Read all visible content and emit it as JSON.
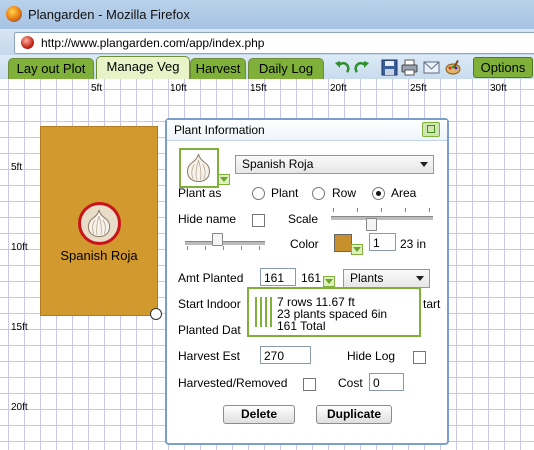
{
  "window": {
    "title": "Plangarden - Mozilla Firefox"
  },
  "browser": {
    "url": "http://www.plangarden.com/app/index.php"
  },
  "tabs": [
    {
      "label": "Lay out Plot",
      "active": false
    },
    {
      "label": "Manage Veg",
      "active": true
    },
    {
      "label": "Harvest",
      "active": false
    },
    {
      "label": "Daily Log",
      "active": false
    }
  ],
  "toolbar": {
    "icons": [
      "undo-icon",
      "redo-icon",
      "save-icon",
      "print-icon",
      "email-icon",
      "paint-icon"
    ],
    "options_label": "Options"
  },
  "ruler": {
    "top": [
      "5ft",
      "10ft",
      "15ft",
      "20ft",
      "25ft",
      "30ft"
    ],
    "left": [
      "5ft",
      "10ft",
      "15ft",
      "20ft"
    ]
  },
  "bed": {
    "label": "Spanish Roja",
    "icon": "garlic-icon",
    "color": "#d1992e"
  },
  "dialog": {
    "title": "Plant Information",
    "plant_select": "Spanish Roja",
    "plant_as_label": "Plant as",
    "plant_as_options": [
      "Plant",
      "Row",
      "Area"
    ],
    "plant_as_selected": "Area",
    "hide_name_label": "Hide name",
    "scale_label": "Scale",
    "color_label": "Color",
    "color_value": "#c8902c",
    "size_value": "1",
    "size_unit": "23 in",
    "amt_planted_label": "Amt Planted",
    "amt_planted_value": "161",
    "amt_planted_count": "161",
    "amt_unit_select": "Plants",
    "start_indoors_label": "Start Indoor",
    "start_suffix": "tart",
    "planted_date_label": "Planted Dat",
    "harvest_est_label": "Harvest Est",
    "harvest_est_value": "270",
    "hide_log_label": "Hide Log",
    "harvested_label": "Harvested/Removed",
    "cost_label": "Cost",
    "cost_value": "0",
    "delete_label": "Delete",
    "duplicate_label": "Duplicate"
  },
  "rows_popup": {
    "line1": "7 rows 11.67 ft",
    "line2": "23 plants spaced 6in",
    "line3": "161 Total"
  }
}
